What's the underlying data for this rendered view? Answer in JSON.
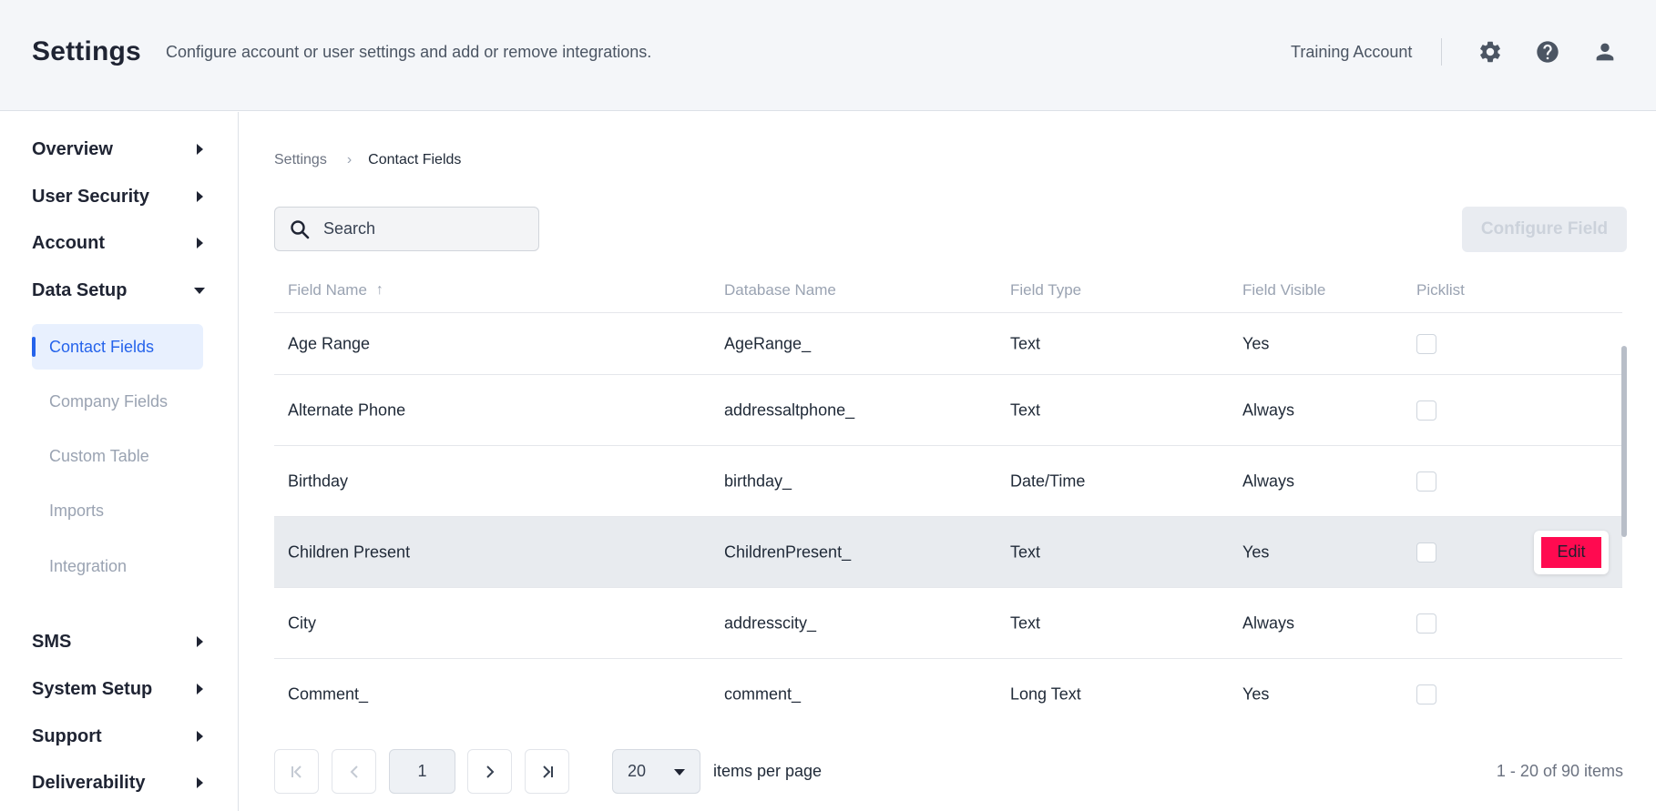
{
  "header": {
    "title": "Settings",
    "subtitle": "Configure account or user settings and add or remove integrations.",
    "account_name": "Training Account",
    "icons": [
      "gear-icon",
      "help-icon",
      "user-icon"
    ]
  },
  "sidebar": {
    "sections": [
      {
        "label": "Overview",
        "expanded": false
      },
      {
        "label": "User Security",
        "expanded": false
      },
      {
        "label": "Account",
        "expanded": false
      },
      {
        "label": "Data Setup",
        "expanded": true
      },
      {
        "label": "SMS",
        "expanded": false
      },
      {
        "label": "System Setup",
        "expanded": false
      },
      {
        "label": "Support",
        "expanded": false
      },
      {
        "label": "Deliverability",
        "expanded": false
      }
    ],
    "data_setup_items": [
      {
        "label": "Contact Fields",
        "active": true
      },
      {
        "label": "Company Fields",
        "active": false
      },
      {
        "label": "Custom Table",
        "active": false
      },
      {
        "label": "Imports",
        "active": false
      },
      {
        "label": "Integration",
        "active": false
      }
    ]
  },
  "breadcrumb": {
    "parent": "Settings",
    "current": "Contact Fields"
  },
  "search": {
    "placeholder": "Search",
    "value": ""
  },
  "configure_button": "Configure Field",
  "table": {
    "columns": [
      "Field Name",
      "Database Name",
      "Field Type",
      "Field Visible",
      "Picklist"
    ],
    "sort_column": "Field Name",
    "sort_direction": "ascending",
    "rows": [
      {
        "field_name": "Age Range",
        "database_name": "AgeRange_",
        "field_type": "Text",
        "field_visible": "Yes",
        "picklist": false
      },
      {
        "field_name": "Alternate Phone",
        "database_name": "addressaltphone_",
        "field_type": "Text",
        "field_visible": "Always",
        "picklist": false
      },
      {
        "field_name": "Birthday",
        "database_name": "birthday_",
        "field_type": "Date/Time",
        "field_visible": "Always",
        "picklist": false
      },
      {
        "field_name": "Children Present",
        "database_name": "ChildrenPresent_",
        "field_type": "Text",
        "field_visible": "Yes",
        "picklist": false,
        "hovered": true
      },
      {
        "field_name": "City",
        "database_name": "addresscity_",
        "field_type": "Text",
        "field_visible": "Always",
        "picklist": false
      },
      {
        "field_name": "Comment_",
        "database_name": "comment_",
        "field_type": "Long Text",
        "field_visible": "Yes",
        "picklist": false
      }
    ],
    "edit_label": "Edit"
  },
  "pagination": {
    "current_page": "1",
    "page_size": "20",
    "items_per_page_label": "items per page",
    "range_text": "1 - 20 of 90 items"
  },
  "colors": {
    "accent": "#2563eb",
    "edit_button": "#ff0a50",
    "header_bg": "#f4f6f9",
    "row_hover": "#e8ebef"
  }
}
